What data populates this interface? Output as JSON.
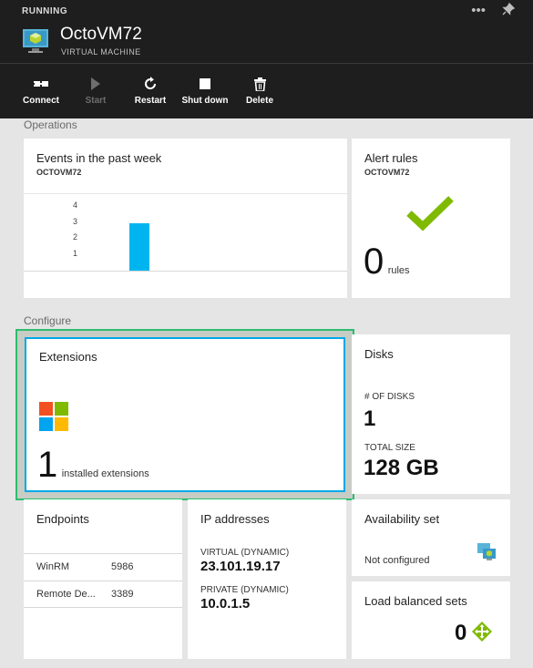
{
  "header": {
    "status": "RUNNING",
    "title": "OctoVM72",
    "subtitle": "VIRTUAL MACHINE",
    "more_icon": "more-icon",
    "pin_icon": "pin-icon"
  },
  "commands": [
    {
      "label": "Connect",
      "icon": "connect-icon",
      "enabled": true
    },
    {
      "label": "Start",
      "icon": "play-icon",
      "enabled": false
    },
    {
      "label": "Restart",
      "icon": "restart-icon",
      "enabled": true
    },
    {
      "label": "Shut down",
      "icon": "stop-icon",
      "enabled": true
    },
    {
      "label": "Delete",
      "icon": "trash-icon",
      "enabled": true
    }
  ],
  "operations": {
    "section_label": "Operations",
    "events": {
      "title": "Events in the past week",
      "vm": "OCTOVM72",
      "chart_data": {
        "type": "bar",
        "y_ticks": [
          "4",
          "3",
          "2",
          "1"
        ],
        "values": [
          3
        ],
        "ylim": [
          0,
          4.5
        ]
      }
    },
    "alerts": {
      "title": "Alert rules",
      "vm": "OCTOVM72",
      "count": "0",
      "unit": "rules",
      "check_color": "#7fba00"
    }
  },
  "configure": {
    "section_label": "Configure",
    "extensions": {
      "title": "Extensions",
      "count": "1",
      "unit": "installed extensions",
      "logo_colors": [
        "#f25022",
        "#7fba00",
        "#00a4ef",
        "#ffb900"
      ]
    },
    "disks": {
      "title": "Disks",
      "count_label": "# OF DISKS",
      "count": "1",
      "size_label": "TOTAL SIZE",
      "size": "128 GB"
    },
    "endpoints": {
      "title": "Endpoints",
      "rows": [
        {
          "name": "WinRM",
          "port": "5986"
        },
        {
          "name": "Remote De...",
          "port": "3389"
        }
      ]
    },
    "ip": {
      "title": "IP addresses",
      "virtual_label": "VIRTUAL (DYNAMIC)",
      "virtual_ip": "23.101.19.17",
      "private_label": "PRIVATE (DYNAMIC)",
      "private_ip": "10.0.1.5"
    },
    "availability": {
      "title": "Availability set",
      "value": "Not configured",
      "icon": "availability-set-icon"
    },
    "load_balanced": {
      "title": "Load balanced sets",
      "count": "0",
      "icon": "load-balancer-icon"
    }
  }
}
